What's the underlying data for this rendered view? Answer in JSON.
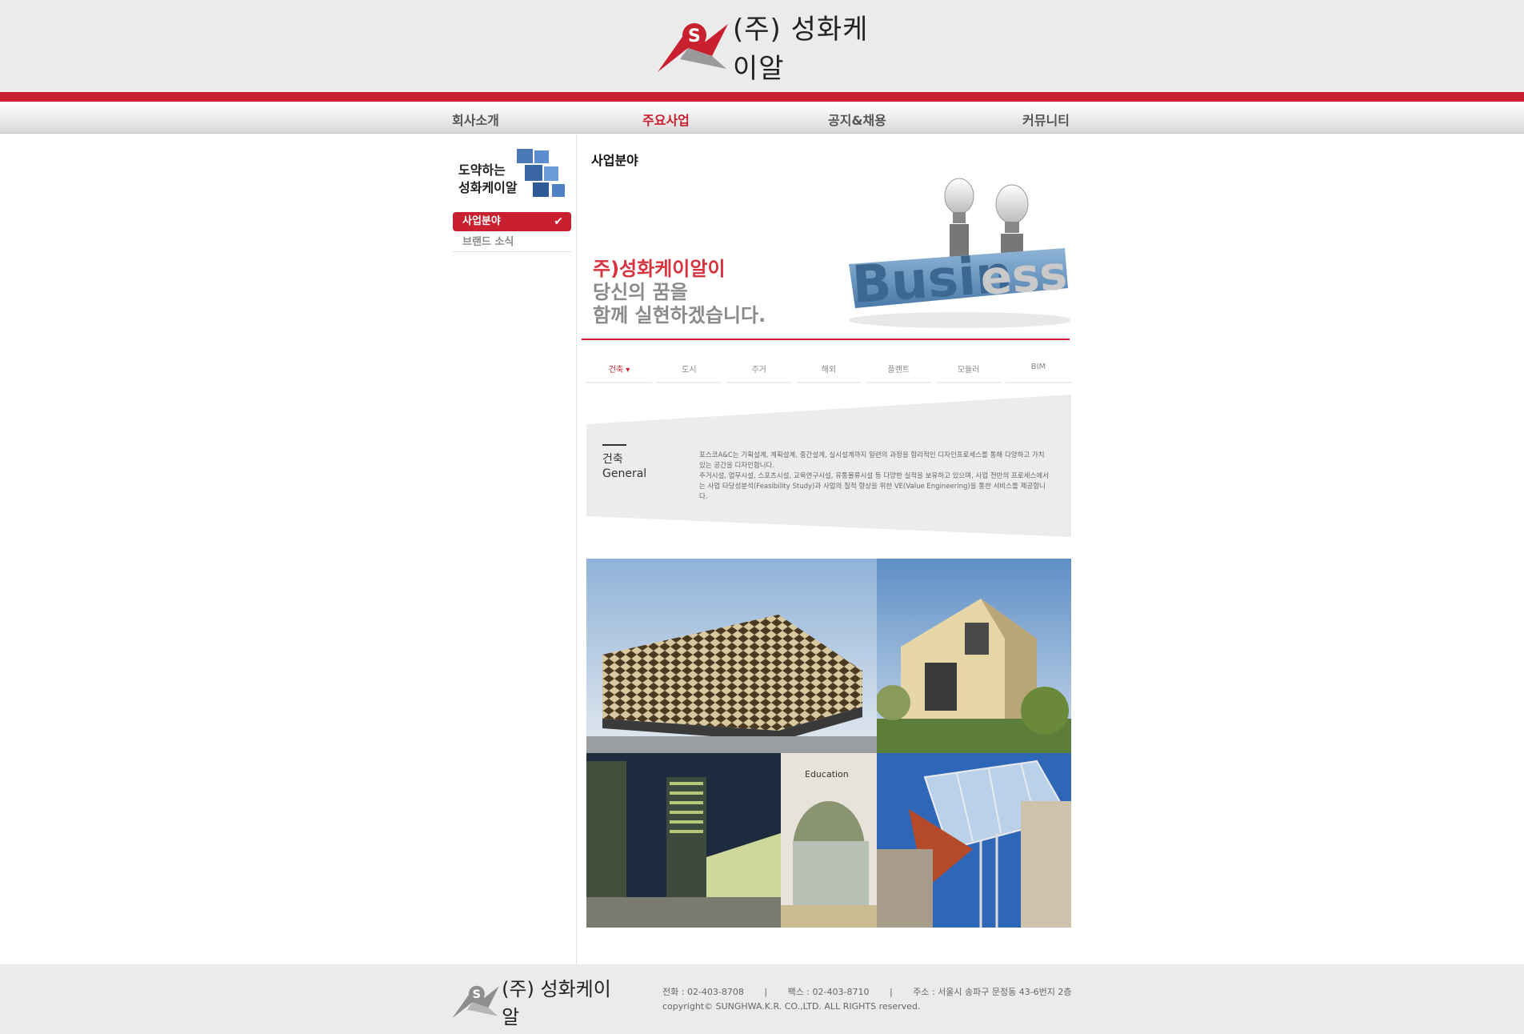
{
  "brand": {
    "name": "(주) 성화케이알"
  },
  "nav": [
    {
      "label": "회사소개"
    },
    {
      "label": "주요사업"
    },
    {
      "label": "공지&채용"
    },
    {
      "label": "커뮤니티"
    }
  ],
  "sidebar": {
    "banner_line1": "도약하는",
    "banner_line2": "성화케이알",
    "items": [
      {
        "label": "사업분야"
      },
      {
        "label": "브랜드 소식"
      }
    ]
  },
  "main": {
    "title": "사업분야",
    "slogan_line1": "주)성화케이알이",
    "slogan_line2": "당신의 꿈을",
    "slogan_line3": "함께 실현하겠습니다.",
    "tabs": [
      {
        "label": "건축"
      },
      {
        "label": "도시"
      },
      {
        "label": "주거"
      },
      {
        "label": "해외"
      },
      {
        "label": "플랜트"
      },
      {
        "label": "모듈러"
      },
      {
        "label": "BIM"
      }
    ],
    "general": {
      "title_ko": "건축",
      "title_en": "General",
      "desc1": "포스코A&C는 기획설계, 계획설계, 중간설계, 실시설계까지 일련의 과정을 합리적인 디자인프로세스를 통해 다양하고 가치 있는 공간을 디자인합니다.",
      "desc2": "주거시설, 업무시설, 스포츠시설, 교육연구시설, 유통물류시설 등 다양한 실적을 보유하고 있으며, 사업 전반의 프로세스에서는 사업 타당성분석(Feasibility Study)과 사업의 질적 향상을 위한 VE(Value Engineering)을 통한 서비스를 제공합니다."
    },
    "photo_caption": "Education"
  },
  "footer": {
    "phone": "전화 : 02-403-8708",
    "fax": "팩스 : 02-403-8710",
    "address": "주소 : 서울시 송파구 문정동 43-6번지 2층",
    "copyright": "copyright© SUNGHWA.K.R. CO.,LTD. ALL RIGHTS reserved."
  },
  "colors": {
    "accent": "#c8202e",
    "header_bg": "#ebebeb"
  }
}
